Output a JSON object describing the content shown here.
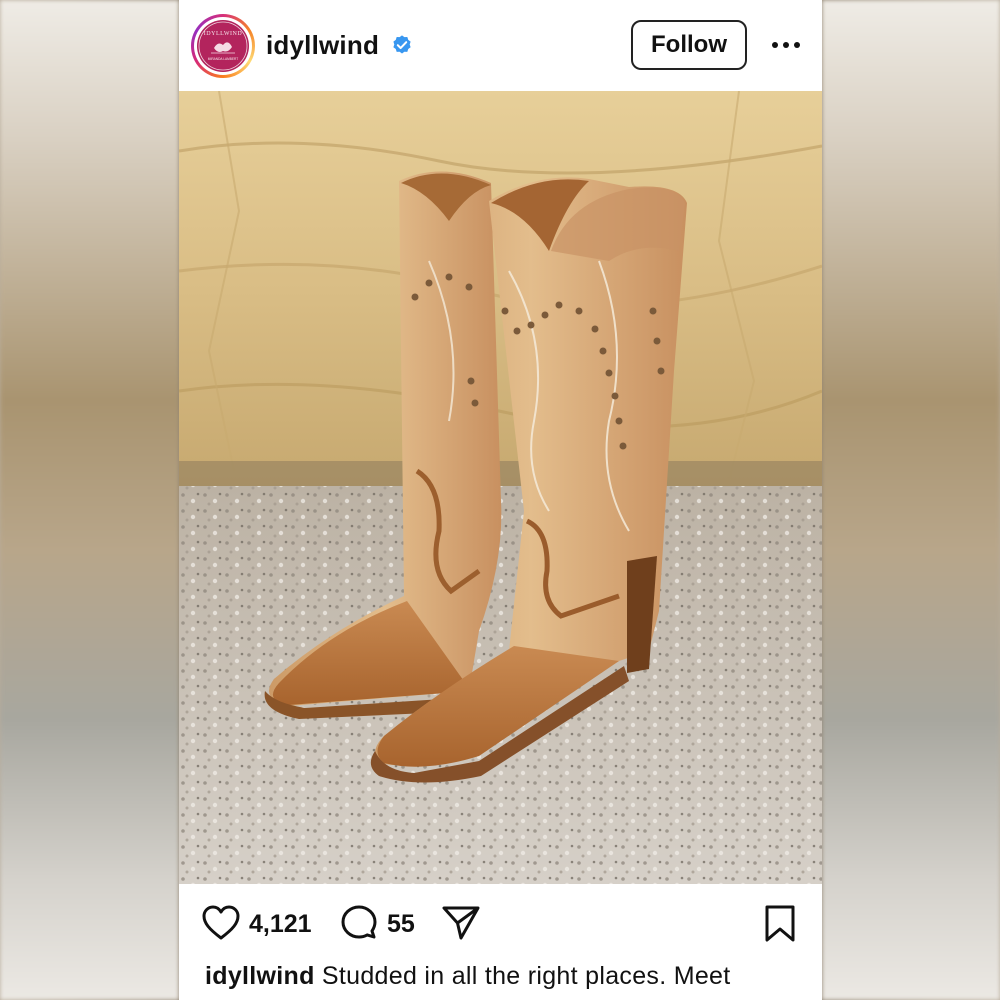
{
  "post": {
    "username": "idyllwind",
    "verified": true,
    "follow_label": "Follow",
    "avatar_logo_text": "IDYLLWIND",
    "avatar_logo_subtext": "MIRANDA LAMBERT",
    "likes": "4,121",
    "comments": "55",
    "caption_username": "idyllwind",
    "caption_text": "Studded in all the right places. Meet"
  },
  "icons": {
    "like": "heart-icon",
    "comment": "comment-bubble-icon",
    "share": "paper-plane-icon",
    "save": "bookmark-icon",
    "more": "more-horizontal-icon",
    "verified": "verified-badge-icon"
  },
  "colors": {
    "verified_blue": "#3897f0",
    "avatar_bg": "#b3245d",
    "text": "#111111"
  }
}
